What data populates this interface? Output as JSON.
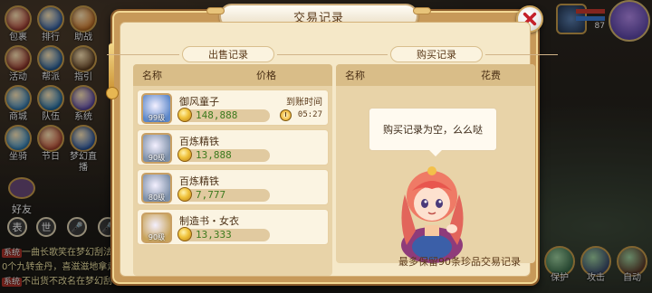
{
  "left_menu": [
    {
      "name": "bag",
      "label": "包裹",
      "color": "#b0463a"
    },
    {
      "name": "rank",
      "label": "排行",
      "color": "#3c6bb1"
    },
    {
      "name": "battle",
      "label": "助战",
      "color": "#d27a2c"
    },
    {
      "name": "event",
      "label": "活动",
      "color": "#9c3b2f"
    },
    {
      "name": "guild",
      "label": "帮派",
      "color": "#2e6aa8"
    },
    {
      "name": "guide",
      "label": "指引",
      "color": "#6e4b2a"
    },
    {
      "name": "shop",
      "label": "商城",
      "color": "#3f8ac2"
    },
    {
      "name": "team",
      "label": "队伍",
      "color": "#2a7ab4"
    },
    {
      "name": "system",
      "label": "系统",
      "color": "#6a56b8"
    },
    {
      "name": "mount",
      "label": "坐骑",
      "color": "#3c90c9"
    },
    {
      "name": "festival",
      "label": "节日",
      "color": "#c2533a"
    },
    {
      "name": "live",
      "label": "梦幻直播",
      "color": "#3565b2"
    }
  ],
  "friend_label": "好友",
  "chat_buttons": [
    "表",
    "世",
    "🎤",
    "🎤"
  ],
  "chat_lines": [
    {
      "tag": "系统",
      "text": "一曲长歌笑在梦幻刮法"
    },
    {
      "tag": "",
      "text": "0个九转金丹，喜滋滋地拿走"
    },
    {
      "tag": "系统",
      "text": "不出货不改名在梦幻刮"
    }
  ],
  "top_right": {
    "level": "87"
  },
  "bottom_right": [
    {
      "name": "shield",
      "label": "保护",
      "color": "#3a6a4a"
    },
    {
      "name": "attack",
      "label": "攻击",
      "color": "#3a4a6a"
    },
    {
      "name": "auto",
      "label": "自动",
      "color": "#5a3a2a"
    }
  ],
  "dialog": {
    "title": "交易记录",
    "sell_title": "出售记录",
    "buy_title": "购买记录",
    "sell_cols": {
      "name": "名称",
      "price": "价格"
    },
    "buy_cols": {
      "name": "名称",
      "cost": "花费"
    },
    "arrive_label": "到账时间",
    "sales": [
      {
        "name": "御风童子",
        "level": "99级",
        "price": "148,888",
        "time": "05:27",
        "icon_color": "#5b87c9"
      },
      {
        "name": "百炼精铁",
        "level": "90级",
        "price": "13,888",
        "time": "",
        "icon_color": "#7c8fa8"
      },
      {
        "name": "百炼精铁",
        "level": "80级",
        "price": "7,777",
        "time": "",
        "icon_color": "#7c8fa8"
      },
      {
        "name": "制造书・女衣",
        "level": "90级",
        "price": "13,333",
        "time": "",
        "icon_color": "#c8a35a"
      }
    ],
    "empty_message": "购买记录为空，么么哒",
    "footer_note": "最多保留90条珍品交易记录"
  }
}
